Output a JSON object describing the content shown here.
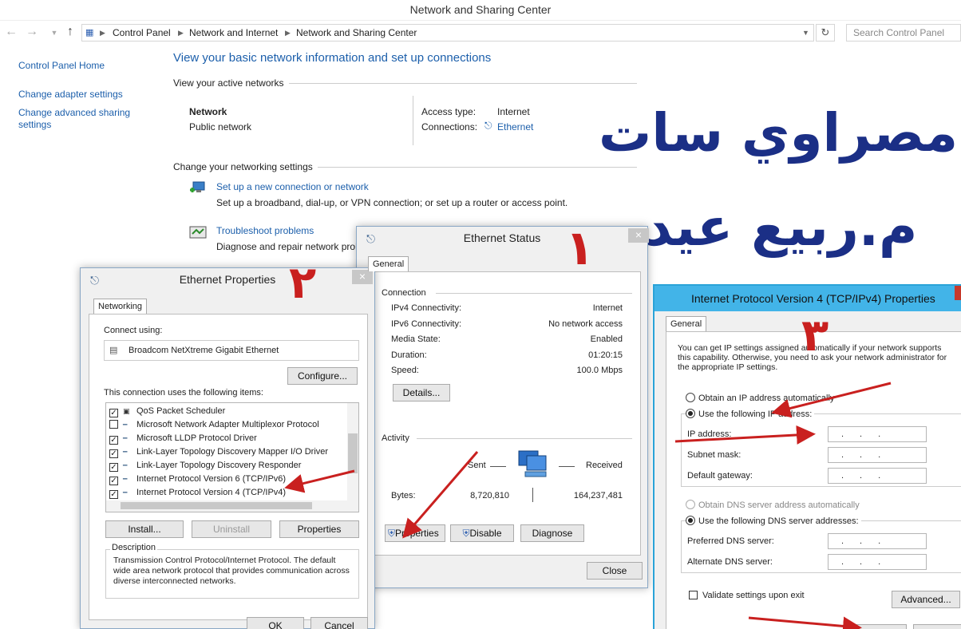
{
  "window": {
    "title": "Network and Sharing Center"
  },
  "address_bar": {
    "crumbs": [
      "Control Panel",
      "Network and Internet",
      "Network and Sharing Center"
    ],
    "search_placeholder": "Search Control Panel"
  },
  "sidebar": {
    "items": [
      "Control Panel Home",
      "Change adapter settings",
      "Change advanced sharing settings"
    ]
  },
  "main": {
    "title": "View your basic network information and set up connections",
    "active_networks_label": "View your active networks",
    "network_name": "Network",
    "network_type": "Public network",
    "access_type_label": "Access type:",
    "access_type_value": "Internet",
    "connections_label": "Connections:",
    "connections_value": "Ethernet",
    "change_settings_label": "Change your networking settings",
    "setup_link": "Set up a new connection or network",
    "setup_desc": "Set up a broadband, dial-up, or VPN connection; or set up a router or access point.",
    "troubleshoot_link": "Troubleshoot problems",
    "troubleshoot_desc": "Diagnose and repair network prol"
  },
  "overlay": {
    "line1": "مصراوي سات",
    "line2": "م.ربيع عيد",
    "step1": "١",
    "step2": "٢",
    "step3": "٣"
  },
  "ethernet_status": {
    "title": "Ethernet Status",
    "close": "×",
    "tab": "General",
    "connection_group": "Connection",
    "rows": [
      {
        "label": "IPv4 Connectivity:",
        "value": "Internet"
      },
      {
        "label": "IPv6 Connectivity:",
        "value": "No network access"
      },
      {
        "label": "Media State:",
        "value": "Enabled"
      },
      {
        "label": "Duration:",
        "value": "01:20:15"
      },
      {
        "label": "Speed:",
        "value": "100.0 Mbps"
      }
    ],
    "details_button": "Details...",
    "activity_group": "Activity",
    "sent_label": "Sent",
    "received_label": "Received",
    "bytes_label": "Bytes:",
    "bytes_sent": "8,720,810",
    "bytes_received": "164,237,481",
    "properties_button": "Properties",
    "disable_button": "Disable",
    "diagnose_button": "Diagnose",
    "close_button": "Close"
  },
  "ethernet_properties": {
    "title": "Ethernet Properties",
    "close": "×",
    "tab": "Networking",
    "connect_using_label": "Connect using:",
    "adapter": "Broadcom NetXtreme Gigabit Ethernet",
    "configure_button": "Configure...",
    "items_label": "This connection uses the following items:",
    "items": [
      "QoS Packet Scheduler",
      "Microsoft Network Adapter Multiplexor Protocol",
      "Microsoft LLDP Protocol Driver",
      "Link-Layer Topology Discovery Mapper I/O Driver",
      "Link-Layer Topology Discovery Responder",
      "Internet Protocol Version 6 (TCP/IPv6)",
      "Internet Protocol Version 4 (TCP/IPv4)"
    ],
    "install_button": "Install...",
    "uninstall_button": "Uninstall",
    "properties_button": "Properties",
    "description_label": "Description",
    "description_text": "Transmission Control Protocol/Internet Protocol. The default wide area network protocol that provides communication across diverse interconnected networks.",
    "ok_button": "OK",
    "cancel_button": "Cancel"
  },
  "ipv4": {
    "title": "Internet Protocol Version 4 (TCP/IPv4) Properties",
    "tab": "General",
    "intro": "You can get IP settings assigned automatically if your network supports this capability. Otherwise, you need to ask your network administrator for the appropriate IP settings.",
    "obtain_ip_auto": "Obtain an IP address automatically",
    "use_following_ip": "Use the following IP address:",
    "ip_address_label": "IP address:",
    "subnet_mask_label": "Subnet mask:",
    "default_gateway_label": "Default gateway:",
    "ip_dots": "...",
    "obtain_dns_auto": "Obtain DNS server address automatically",
    "use_following_dns": "Use the following DNS server addresses:",
    "preferred_dns_label": "Preferred DNS server:",
    "alternate_dns_label": "Alternate DNS server:",
    "validate_label": "Validate settings upon exit",
    "advanced_button": "Advanced..."
  },
  "colors": {
    "link": "#1c5fab",
    "overlay_text": "#1b2f86",
    "arrow": "#c9201f"
  }
}
